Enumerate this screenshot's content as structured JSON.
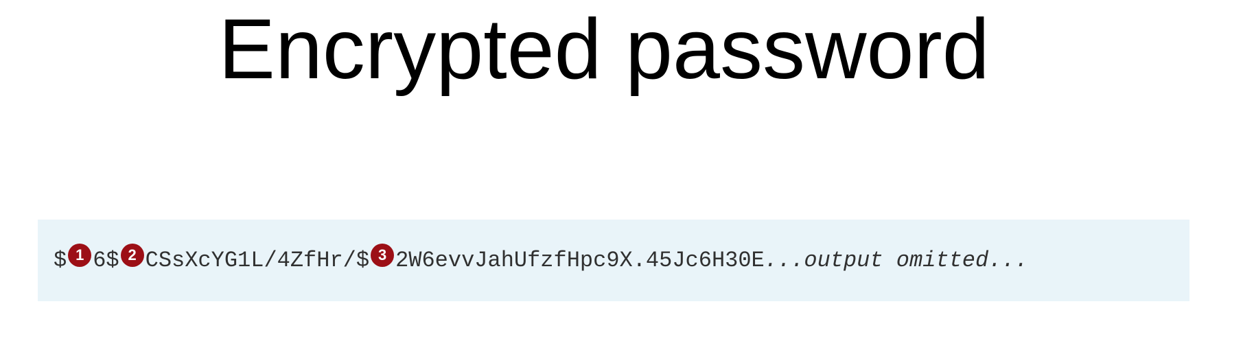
{
  "slide": {
    "title": "Encrypted password"
  },
  "code": {
    "seg1": "$",
    "callout1": "1",
    "seg2": "6$",
    "callout2": "2",
    "seg3": "CSsXcYG1L/4ZfHr/$",
    "callout3": "3",
    "seg4": "2W6evvJahUfzfHpc9X.45Jc6H30E",
    "omitted": "...output omitted...",
    "background_color": "#e9f4f9",
    "callout_color": "#9c0f16"
  }
}
